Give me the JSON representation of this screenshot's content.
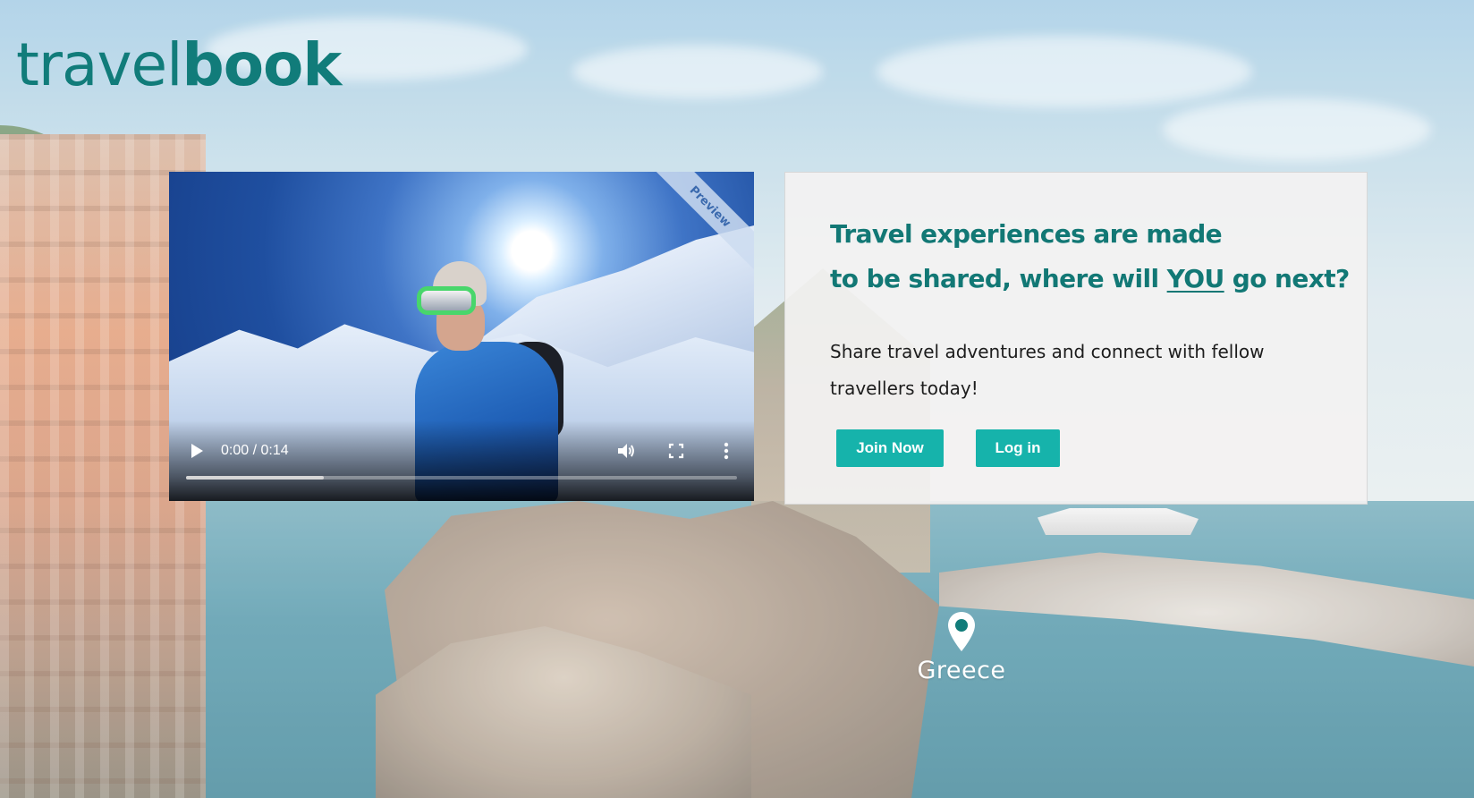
{
  "logo": {
    "part_light": "travel",
    "part_bold": "book"
  },
  "video": {
    "badge": "Preview",
    "time": "0:00 / 0:14",
    "progress": 0.25,
    "icons": {
      "play": "play-icon",
      "volume": "volume-icon",
      "fullscreen": "fullscreen-icon",
      "more": "more-options-icon"
    }
  },
  "panel": {
    "headline_line1": "Travel experiences are made",
    "headline_line2_pre": "to be shared, where will ",
    "headline_emphasis": "YOU",
    "headline_line2_post": " go next?",
    "subtext": "Share travel adventures and connect with fellow travellers today!",
    "join_label": "Join Now",
    "login_label": "Log in"
  },
  "location": {
    "name": "Greece",
    "icon": "map-pin-icon"
  },
  "colors": {
    "brand": "#117c7a",
    "button": "#16b3ab",
    "headline": "#127875"
  }
}
